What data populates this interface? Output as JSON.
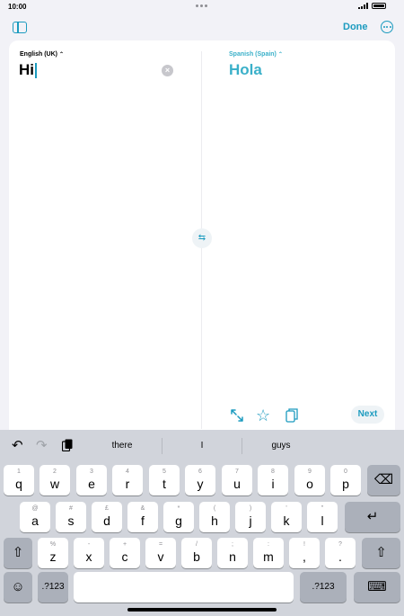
{
  "status_bar": {
    "time": "10:00"
  },
  "toolbar": {
    "done_label": "Done"
  },
  "translation": {
    "source_language": "English (UK)",
    "target_language": "Spanish (Spain)",
    "source_text": "Hi",
    "target_text": "Hola",
    "next_label": "Next"
  },
  "colors": {
    "accent": "#1c9bbf",
    "translated_text": "#3ab0c9",
    "keyboard_bg": "#d1d4db"
  },
  "keyboard": {
    "suggestions": [
      "there",
      "I",
      "guys"
    ],
    "row1": [
      {
        "sub": "1",
        "main": "q"
      },
      {
        "sub": "2",
        "main": "w"
      },
      {
        "sub": "3",
        "main": "e"
      },
      {
        "sub": "4",
        "main": "r"
      },
      {
        "sub": "5",
        "main": "t"
      },
      {
        "sub": "6",
        "main": "y"
      },
      {
        "sub": "7",
        "main": "u"
      },
      {
        "sub": "8",
        "main": "i"
      },
      {
        "sub": "9",
        "main": "o"
      },
      {
        "sub": "0",
        "main": "p"
      }
    ],
    "row2": [
      {
        "sub": "@",
        "main": "a"
      },
      {
        "sub": "#",
        "main": "s"
      },
      {
        "sub": "£",
        "main": "d"
      },
      {
        "sub": "&",
        "main": "f"
      },
      {
        "sub": "*",
        "main": "g"
      },
      {
        "sub": "(",
        "main": "h"
      },
      {
        "sub": ")",
        "main": "j"
      },
      {
        "sub": "'",
        "main": "k"
      },
      {
        "sub": "\"",
        "main": "l"
      }
    ],
    "row3": [
      {
        "sub": "%",
        "main": "z"
      },
      {
        "sub": "-",
        "main": "x"
      },
      {
        "sub": "+",
        "main": "c"
      },
      {
        "sub": "=",
        "main": "v"
      },
      {
        "sub": "/",
        "main": "b"
      },
      {
        "sub": ";",
        "main": "n"
      },
      {
        "sub": ":",
        "main": "m"
      },
      {
        "sub": "!",
        "main": ","
      },
      {
        "sub": "?",
        "main": "."
      }
    ],
    "numbers_label": ".?123"
  }
}
